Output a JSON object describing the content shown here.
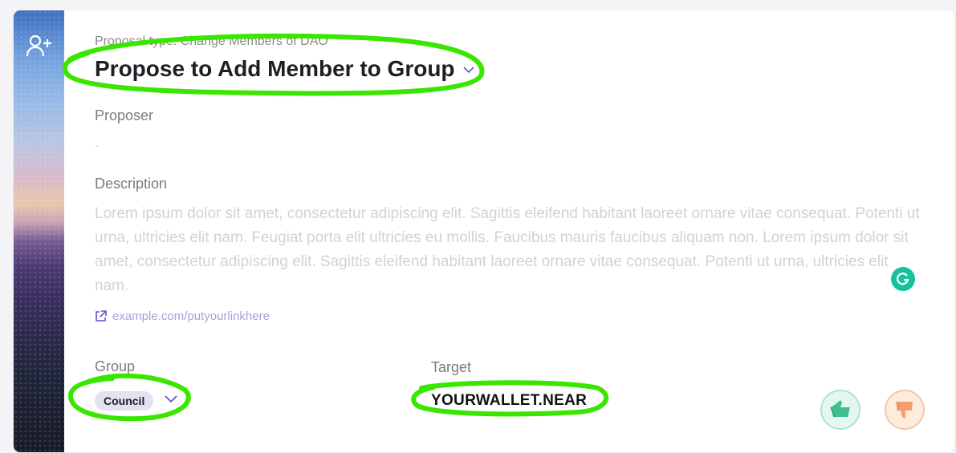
{
  "proposal": {
    "type_line": "Proposal type: Change Members of DAO",
    "title": "Propose to Add Member to Group"
  },
  "proposer": {
    "label": "Proposer",
    "value": "-"
  },
  "description": {
    "label": "Description",
    "text": "Lorem ipsum dolor sit amet, consectetur adipiscing elit. Sagittis eleifend habitant laoreet ornare vitae consequat. Potenti ut urna, ultricies elit nam. Feugiat porta elit ultricies eu mollis. Faucibus mauris faucibus aliquam non. Lorem ipsum dolor sit amet, consectetur adipiscing elit. Sagittis eleifend habitant laoreet ornare vitae consequat. Potenti ut urna, ultricies elit nam.",
    "link": "example.com/putyourlinkhere"
  },
  "group": {
    "label": "Group",
    "value": "Council"
  },
  "target": {
    "label": "Target",
    "value": "YOURWALLET.NEAR"
  },
  "icons": {
    "side": "add-user-icon",
    "link": "external-link-icon",
    "vote_up": "thumbs-up-icon",
    "vote_down": "thumbs-down-icon",
    "assistant": "grammarly-icon"
  },
  "colors": {
    "highlight": "#39e600",
    "accent": "#6b4fd8",
    "vote_up": "#3fbf8f",
    "vote_down": "#f2a06b"
  }
}
